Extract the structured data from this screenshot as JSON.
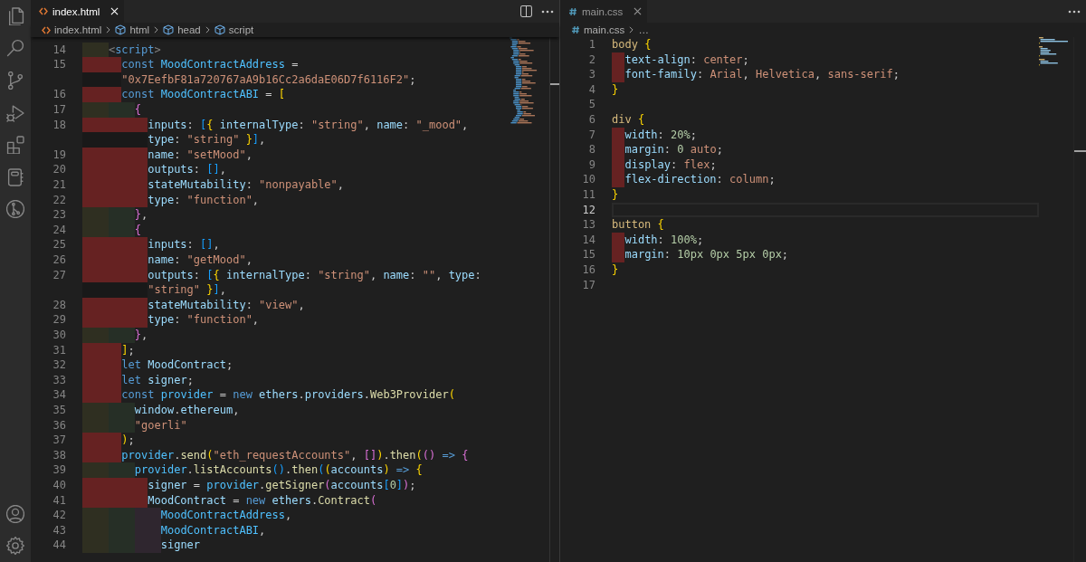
{
  "editor_groups": [
    {
      "focused": true,
      "tabs": [
        {
          "label": "index.html",
          "kind": "html",
          "selected": true
        }
      ],
      "breadcrumb": [
        {
          "label": "index.html",
          "kind": "html"
        },
        {
          "label": "html",
          "kind": "element"
        },
        {
          "label": "head",
          "kind": "element"
        },
        {
          "label": "script",
          "kind": "element"
        }
      ],
      "lines": [
        {
          "number": "14",
          "indent_error": false,
          "tokens": [
            {
              "text": "    <",
              "kind": "angle"
            },
            {
              "text": "script",
              "kind": "tag"
            },
            {
              "text": ">",
              "kind": "angle"
            }
          ]
        },
        {
          "number": "15",
          "indent_error": true,
          "tokens": [
            {
              "text": "      const ",
              "kind": "keyword"
            },
            {
              "text": "MoodContractAddress",
              "kind": "constant"
            },
            {
              "text": " =",
              "kind": "plain"
            }
          ],
          "wrapped": [
            {
              "text": "\"0x7EefbF81a720767aA9b16Cc2a6daE06D7f6116F2\"",
              "kind": "string"
            },
            {
              "text": ";",
              "kind": "plain"
            }
          ]
        },
        {
          "number": "16",
          "indent_error": true,
          "tokens": [
            {
              "text": "      const ",
              "kind": "keyword"
            },
            {
              "text": "MoodContractABI",
              "kind": "constant"
            },
            {
              "text": " = ",
              "kind": "plain"
            },
            {
              "text": "[",
              "kind": "bracket1"
            }
          ]
        },
        {
          "number": "17",
          "indent_error": false,
          "tokens": [
            {
              "text": "        {",
              "kind": "bracket2"
            }
          ]
        },
        {
          "number": "18",
          "indent_error": true,
          "tokens": [
            {
              "text": "          inputs",
              "kind": "variable"
            },
            {
              "text": ": ",
              "kind": "plain"
            },
            {
              "text": "[",
              "kind": "bracket3"
            },
            {
              "text": "{ ",
              "kind": "bracket1"
            },
            {
              "text": "internalType",
              "kind": "variable"
            },
            {
              "text": ": ",
              "kind": "plain"
            },
            {
              "text": "\"string\"",
              "kind": "string"
            },
            {
              "text": ", ",
              "kind": "plain"
            },
            {
              "text": "name",
              "kind": "variable"
            },
            {
              "text": ": ",
              "kind": "plain"
            },
            {
              "text": "\"_mood\"",
              "kind": "string"
            },
            {
              "text": ",",
              "kind": "plain"
            }
          ],
          "wrapped": [
            {
              "text": "type",
              "kind": "variable"
            },
            {
              "text": ": ",
              "kind": "plain"
            },
            {
              "text": "\"string\"",
              "kind": "string"
            },
            {
              "text": " }",
              "kind": "bracket1"
            },
            {
              "text": "]",
              "kind": "bracket3"
            },
            {
              "text": ",",
              "kind": "plain"
            }
          ]
        },
        {
          "number": "19",
          "indent_error": true,
          "tokens": [
            {
              "text": "          name",
              "kind": "variable"
            },
            {
              "text": ": ",
              "kind": "plain"
            },
            {
              "text": "\"setMood\"",
              "kind": "string"
            },
            {
              "text": ",",
              "kind": "plain"
            }
          ]
        },
        {
          "number": "20",
          "indent_error": true,
          "tokens": [
            {
              "text": "          outputs",
              "kind": "variable"
            },
            {
              "text": ": ",
              "kind": "plain"
            },
            {
              "text": "[]",
              "kind": "bracket3"
            },
            {
              "text": ",",
              "kind": "plain"
            }
          ]
        },
        {
          "number": "21",
          "indent_error": true,
          "tokens": [
            {
              "text": "          stateMutability",
              "kind": "variable"
            },
            {
              "text": ": ",
              "kind": "plain"
            },
            {
              "text": "\"nonpayable\"",
              "kind": "string"
            },
            {
              "text": ",",
              "kind": "plain"
            }
          ]
        },
        {
          "number": "22",
          "indent_error": true,
          "tokens": [
            {
              "text": "          type",
              "kind": "variable"
            },
            {
              "text": ": ",
              "kind": "plain"
            },
            {
              "text": "\"function\"",
              "kind": "string"
            },
            {
              "text": ",",
              "kind": "plain"
            }
          ]
        },
        {
          "number": "23",
          "indent_error": false,
          "tokens": [
            {
              "text": "        }",
              "kind": "bracket2"
            },
            {
              "text": ",",
              "kind": "plain"
            }
          ]
        },
        {
          "number": "24",
          "indent_error": false,
          "tokens": [
            {
              "text": "        {",
              "kind": "bracket2"
            }
          ]
        },
        {
          "number": "25",
          "indent_error": true,
          "tokens": [
            {
              "text": "          inputs",
              "kind": "variable"
            },
            {
              "text": ": ",
              "kind": "plain"
            },
            {
              "text": "[]",
              "kind": "bracket3"
            },
            {
              "text": ",",
              "kind": "plain"
            }
          ]
        },
        {
          "number": "26",
          "indent_error": true,
          "tokens": [
            {
              "text": "          name",
              "kind": "variable"
            },
            {
              "text": ": ",
              "kind": "plain"
            },
            {
              "text": "\"getMood\"",
              "kind": "string"
            },
            {
              "text": ",",
              "kind": "plain"
            }
          ]
        },
        {
          "number": "27",
          "indent_error": true,
          "tokens": [
            {
              "text": "          outputs",
              "kind": "variable"
            },
            {
              "text": ": ",
              "kind": "plain"
            },
            {
              "text": "[",
              "kind": "bracket3"
            },
            {
              "text": "{ ",
              "kind": "bracket1"
            },
            {
              "text": "internalType",
              "kind": "variable"
            },
            {
              "text": ": ",
              "kind": "plain"
            },
            {
              "text": "\"string\"",
              "kind": "string"
            },
            {
              "text": ", ",
              "kind": "plain"
            },
            {
              "text": "name",
              "kind": "variable"
            },
            {
              "text": ": ",
              "kind": "plain"
            },
            {
              "text": "\"\"",
              "kind": "string"
            },
            {
              "text": ", ",
              "kind": "plain"
            },
            {
              "text": "type",
              "kind": "variable"
            },
            {
              "text": ":",
              "kind": "plain"
            }
          ],
          "wrapped": [
            {
              "text": "\"string\"",
              "kind": "string"
            },
            {
              "text": " }",
              "kind": "bracket1"
            },
            {
              "text": "]",
              "kind": "bracket3"
            },
            {
              "text": ",",
              "kind": "plain"
            }
          ]
        },
        {
          "number": "28",
          "indent_error": true,
          "tokens": [
            {
              "text": "          stateMutability",
              "kind": "variable"
            },
            {
              "text": ": ",
              "kind": "plain"
            },
            {
              "text": "\"view\"",
              "kind": "string"
            },
            {
              "text": ",",
              "kind": "plain"
            }
          ]
        },
        {
          "number": "29",
          "indent_error": true,
          "tokens": [
            {
              "text": "          type",
              "kind": "variable"
            },
            {
              "text": ": ",
              "kind": "plain"
            },
            {
              "text": "\"function\"",
              "kind": "string"
            },
            {
              "text": ",",
              "kind": "plain"
            }
          ]
        },
        {
          "number": "30",
          "indent_error": false,
          "tokens": [
            {
              "text": "        }",
              "kind": "bracket2"
            },
            {
              "text": ",",
              "kind": "plain"
            }
          ]
        },
        {
          "number": "31",
          "indent_error": true,
          "tokens": [
            {
              "text": "      ]",
              "kind": "bracket1"
            },
            {
              "text": ";",
              "kind": "plain"
            }
          ]
        },
        {
          "number": "32",
          "indent_error": true,
          "tokens": [
            {
              "text": "      let ",
              "kind": "keyword"
            },
            {
              "text": "MoodContract",
              "kind": "variable"
            },
            {
              "text": ";",
              "kind": "plain"
            }
          ]
        },
        {
          "number": "33",
          "indent_error": true,
          "tokens": [
            {
              "text": "      let ",
              "kind": "keyword"
            },
            {
              "text": "signer",
              "kind": "variable"
            },
            {
              "text": ";",
              "kind": "plain"
            }
          ]
        },
        {
          "number": "34",
          "indent_error": true,
          "tokens": [
            {
              "text": "      const ",
              "kind": "keyword"
            },
            {
              "text": "provider",
              "kind": "constant"
            },
            {
              "text": " = ",
              "kind": "plain"
            },
            {
              "text": "new ",
              "kind": "keyword"
            },
            {
              "text": "ethers",
              "kind": "variable"
            },
            {
              "text": ".",
              "kind": "plain"
            },
            {
              "text": "providers",
              "kind": "variable"
            },
            {
              "text": ".",
              "kind": "plain"
            },
            {
              "text": "Web3Provider",
              "kind": "function"
            },
            {
              "text": "(",
              "kind": "bracket1"
            }
          ]
        },
        {
          "number": "35",
          "indent_error": false,
          "tokens": [
            {
              "text": "        window",
              "kind": "variable"
            },
            {
              "text": ".",
              "kind": "plain"
            },
            {
              "text": "ethereum",
              "kind": "variable"
            },
            {
              "text": ",",
              "kind": "plain"
            }
          ]
        },
        {
          "number": "36",
          "indent_error": false,
          "tokens": [
            {
              "text": "        \"goerli\"",
              "kind": "string"
            }
          ]
        },
        {
          "number": "37",
          "indent_error": true,
          "tokens": [
            {
              "text": "      )",
              "kind": "bracket1"
            },
            {
              "text": ";",
              "kind": "plain"
            }
          ]
        },
        {
          "number": "38",
          "indent_error": true,
          "tokens": [
            {
              "text": "      provider",
              "kind": "constant"
            },
            {
              "text": ".",
              "kind": "plain"
            },
            {
              "text": "send",
              "kind": "function"
            },
            {
              "text": "(",
              "kind": "bracket1"
            },
            {
              "text": "\"eth_requestAccounts\"",
              "kind": "string"
            },
            {
              "text": ", ",
              "kind": "plain"
            },
            {
              "text": "[]",
              "kind": "bracket2"
            },
            {
              "text": ")",
              "kind": "bracket1"
            },
            {
              "text": ".",
              "kind": "plain"
            },
            {
              "text": "then",
              "kind": "function"
            },
            {
              "text": "(",
              "kind": "bracket1"
            },
            {
              "text": "()",
              "kind": "bracket2"
            },
            {
              "text": " => ",
              "kind": "keyword"
            },
            {
              "text": "{",
              "kind": "bracket2"
            }
          ]
        },
        {
          "number": "39",
          "indent_error": false,
          "tokens": [
            {
              "text": "        provider",
              "kind": "constant"
            },
            {
              "text": ".",
              "kind": "plain"
            },
            {
              "text": "listAccounts",
              "kind": "function"
            },
            {
              "text": "()",
              "kind": "bracket3"
            },
            {
              "text": ".",
              "kind": "plain"
            },
            {
              "text": "then",
              "kind": "function"
            },
            {
              "text": "(",
              "kind": "bracket3"
            },
            {
              "text": "(",
              "kind": "bracket1"
            },
            {
              "text": "accounts",
              "kind": "variable"
            },
            {
              "text": ")",
              "kind": "bracket1"
            },
            {
              "text": " => ",
              "kind": "keyword"
            },
            {
              "text": "{",
              "kind": "bracket1"
            }
          ]
        },
        {
          "number": "40",
          "indent_error": true,
          "tokens": [
            {
              "text": "          signer",
              "kind": "variable"
            },
            {
              "text": " = ",
              "kind": "plain"
            },
            {
              "text": "provider",
              "kind": "constant"
            },
            {
              "text": ".",
              "kind": "plain"
            },
            {
              "text": "getSigner",
              "kind": "function"
            },
            {
              "text": "(",
              "kind": "bracket2"
            },
            {
              "text": "accounts",
              "kind": "variable"
            },
            {
              "text": "[",
              "kind": "bracket3"
            },
            {
              "text": "0",
              "kind": "number"
            },
            {
              "text": "]",
              "kind": "bracket3"
            },
            {
              "text": ")",
              "kind": "bracket2"
            },
            {
              "text": ";",
              "kind": "plain"
            }
          ]
        },
        {
          "number": "41",
          "indent_error": true,
          "tokens": [
            {
              "text": "          MoodContract",
              "kind": "variable"
            },
            {
              "text": " = ",
              "kind": "plain"
            },
            {
              "text": "new ",
              "kind": "keyword"
            },
            {
              "text": "ethers",
              "kind": "variable"
            },
            {
              "text": ".",
              "kind": "plain"
            },
            {
              "text": "Contract",
              "kind": "function"
            },
            {
              "text": "(",
              "kind": "bracket2"
            }
          ]
        },
        {
          "number": "42",
          "indent_error": false,
          "tokens": [
            {
              "text": "            MoodContractAddress",
              "kind": "constant"
            },
            {
              "text": ",",
              "kind": "plain"
            }
          ]
        },
        {
          "number": "43",
          "indent_error": false,
          "tokens": [
            {
              "text": "            MoodContractABI",
              "kind": "constant"
            },
            {
              "text": ",",
              "kind": "plain"
            }
          ]
        },
        {
          "number": "44",
          "indent_error": false,
          "tokens": [
            {
              "text": "            signer",
              "kind": "variable"
            }
          ]
        }
      ]
    },
    {
      "focused": false,
      "tabs": [
        {
          "label": "main.css",
          "kind": "css",
          "selected": true
        }
      ],
      "breadcrumb": [
        {
          "label": "main.css",
          "kind": "css"
        },
        {
          "label": "…",
          "kind": "more"
        }
      ],
      "lines": [
        {
          "number": "1",
          "active": false,
          "tokens": [
            {
              "text": "body",
              "kind": "selector"
            },
            {
              "text": " {",
              "kind": "bracket1"
            }
          ]
        },
        {
          "number": "2",
          "active": false,
          "indent_error": true,
          "tokens": [
            {
              "text": "  text-align",
              "kind": "property"
            },
            {
              "text": ": ",
              "kind": "plain"
            },
            {
              "text": "center",
              "kind": "value"
            },
            {
              "text": ";",
              "kind": "plain"
            }
          ]
        },
        {
          "number": "3",
          "active": false,
          "indent_error": true,
          "tokens": [
            {
              "text": "  font-family",
              "kind": "property"
            },
            {
              "text": ": ",
              "kind": "plain"
            },
            {
              "text": "Arial",
              "kind": "value"
            },
            {
              "text": ", ",
              "kind": "plain"
            },
            {
              "text": "Helvetica",
              "kind": "value"
            },
            {
              "text": ", ",
              "kind": "plain"
            },
            {
              "text": "sans-serif",
              "kind": "value"
            },
            {
              "text": ";",
              "kind": "plain"
            }
          ]
        },
        {
          "number": "4",
          "active": false,
          "tokens": [
            {
              "text": "}",
              "kind": "bracket1"
            }
          ]
        },
        {
          "number": "5",
          "active": false
        },
        {
          "number": "6",
          "active": false,
          "tokens": [
            {
              "text": "div",
              "kind": "selector"
            },
            {
              "text": " {",
              "kind": "bracket1"
            }
          ]
        },
        {
          "number": "7",
          "active": false,
          "indent_error": true,
          "tokens": [
            {
              "text": "  width",
              "kind": "property"
            },
            {
              "text": ": ",
              "kind": "plain"
            },
            {
              "text": "20%",
              "kind": "number"
            },
            {
              "text": ";",
              "kind": "plain"
            }
          ]
        },
        {
          "number": "8",
          "active": false,
          "indent_error": true,
          "tokens": [
            {
              "text": "  margin",
              "kind": "property"
            },
            {
              "text": ": ",
              "kind": "plain"
            },
            {
              "text": "0",
              "kind": "number"
            },
            {
              "text": " auto",
              "kind": "value"
            },
            {
              "text": ";",
              "kind": "plain"
            }
          ]
        },
        {
          "number": "9",
          "active": false,
          "indent_error": true,
          "tokens": [
            {
              "text": "  display",
              "kind": "property"
            },
            {
              "text": ": ",
              "kind": "plain"
            },
            {
              "text": "flex",
              "kind": "value"
            },
            {
              "text": ";",
              "kind": "plain"
            }
          ]
        },
        {
          "number": "10",
          "active": false,
          "indent_error": true,
          "tokens": [
            {
              "text": "  flex-direction",
              "kind": "property"
            },
            {
              "text": ": ",
              "kind": "plain"
            },
            {
              "text": "column",
              "kind": "value"
            },
            {
              "text": ";",
              "kind": "plain"
            }
          ]
        },
        {
          "number": "11",
          "active": false,
          "tokens": [
            {
              "text": "}",
              "kind": "bracket1"
            }
          ]
        },
        {
          "number": "12",
          "active": true
        },
        {
          "number": "13",
          "active": false,
          "tokens": [
            {
              "text": "button",
              "kind": "selector"
            },
            {
              "text": " {",
              "kind": "bracket1"
            }
          ]
        },
        {
          "number": "14",
          "active": false,
          "indent_error": true,
          "tokens": [
            {
              "text": "  width",
              "kind": "property"
            },
            {
              "text": ": ",
              "kind": "plain"
            },
            {
              "text": "100%",
              "kind": "number"
            },
            {
              "text": ";",
              "kind": "plain"
            }
          ]
        },
        {
          "number": "15",
          "active": false,
          "indent_error": true,
          "tokens": [
            {
              "text": "  margin",
              "kind": "property"
            },
            {
              "text": ": ",
              "kind": "plain"
            },
            {
              "text": "10px 0px 5px 0px",
              "kind": "number"
            },
            {
              "text": ";",
              "kind": "plain"
            }
          ]
        },
        {
          "number": "16",
          "active": false,
          "tokens": [
            {
              "text": "}",
              "kind": "bracket1"
            }
          ]
        },
        {
          "number": "17",
          "active": false
        }
      ]
    }
  ]
}
